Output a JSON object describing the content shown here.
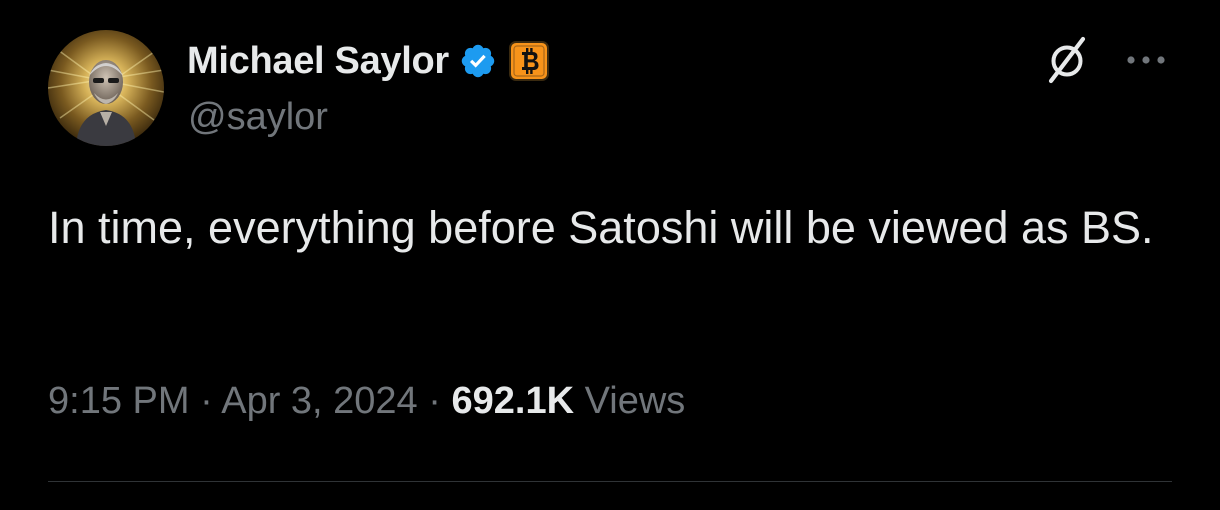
{
  "author": {
    "display_name": "Michael Saylor",
    "handle": "@saylor",
    "verified": true,
    "affiliate_badge": "bitcoin-badge-icon"
  },
  "tweet": {
    "text": "In time, everything before Satoshi will be viewed as BS."
  },
  "meta": {
    "time": "9:15 PM",
    "separator": "·",
    "date": "Apr 3, 2024",
    "views_count": "692.1K",
    "views_label": "Views"
  },
  "icons": {
    "top_right": [
      "grok-icon",
      "more-icon"
    ]
  },
  "colors": {
    "background": "#000000",
    "primary_text": "#e7e9ea",
    "secondary_text": "#71767b",
    "verified_blue": "#1d9bf0",
    "bitcoin_orange": "#f7931a",
    "divider": "#2f3336"
  }
}
